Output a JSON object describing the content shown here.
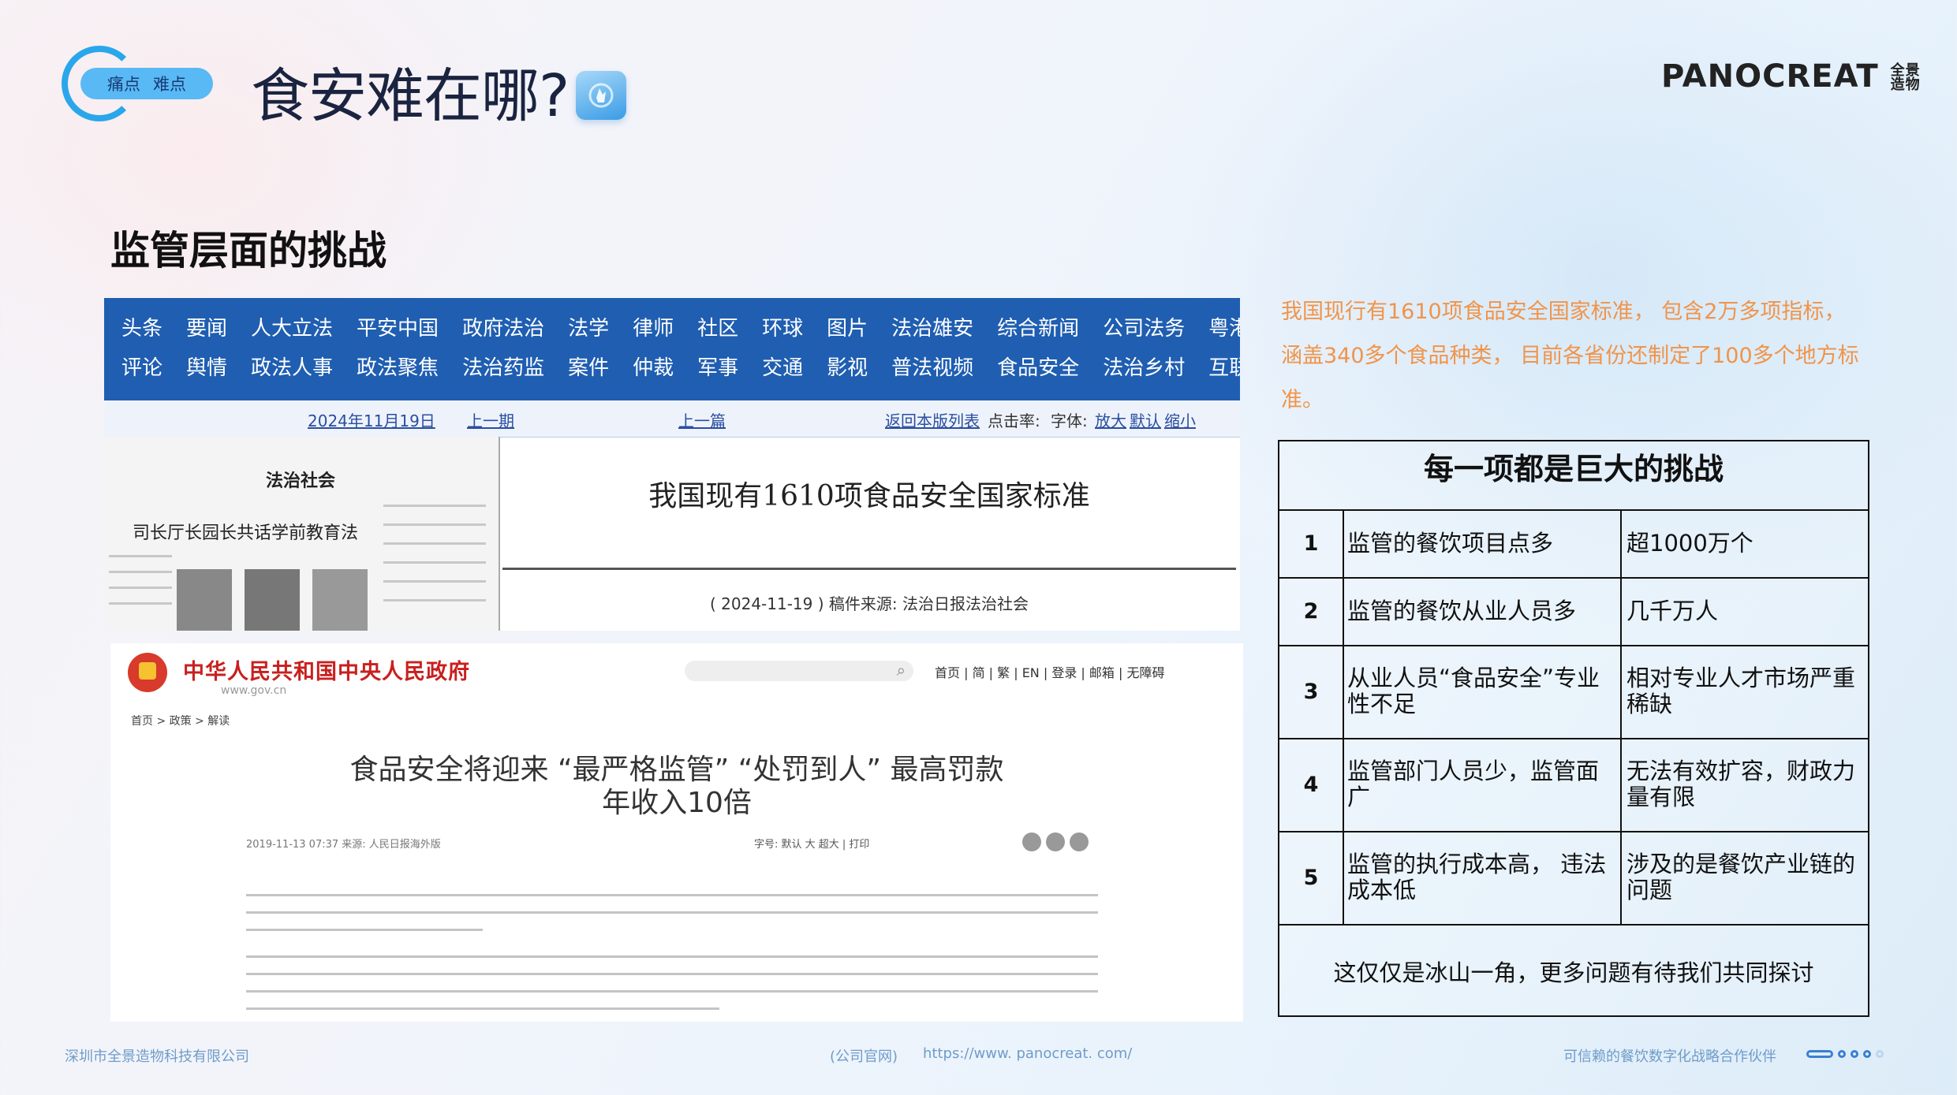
{
  "header": {
    "badge_left": "痛点",
    "badge_right": "难点",
    "title": "食安难在哪?",
    "logo_text": "PANOCREAT",
    "logo_cn": "全景造物"
  },
  "section_title": "监管层面的挑战",
  "screenshot1": {
    "nav_row1": [
      "头条",
      "要闻",
      "人大立法",
      "平安中国",
      "政府法治",
      "法学",
      "律师",
      "社区",
      "环球",
      "图片",
      "法治雄安",
      "综合新闻",
      "公司法务",
      "粤港澳大湾区"
    ],
    "nav_row2": [
      "评论",
      "舆情",
      "政法人事",
      "政法聚焦",
      "法治药监",
      "案件",
      "仲裁",
      "军事",
      "交通",
      "影视",
      "普法视频",
      "食品安全",
      "法治乡村",
      "互联网法治"
    ],
    "date": "2024年11月19日",
    "prev_page": "上一期",
    "prev_article": "上一篇",
    "return_link": "返回本版列表",
    "clicks_label": "点击率:",
    "font_label": "字体:",
    "font_big": "放大",
    "font_default": "默认",
    "font_small": "缩小",
    "paper_section": "法治社会",
    "paper_headline": "司长厅长园长共话学前教育法",
    "article_title": "我国现有1610项食品安全国家标准",
    "article_meta": "( 2024-11-19 )   稿件来源:  法治日报法治社会"
  },
  "screenshot2": {
    "gov_name": "中华人民共和国中央人民政府",
    "gov_url": "www.gov.cn",
    "nav_links": "首页 | 简 | 繁 | EN | 登录 | 邮箱 | 无障碍",
    "breadcrumb": "首页  >  政策  >  解读",
    "news_title_line1": "食品安全将迎来 “最严格监管”  “处罚到人” 最高罚款",
    "news_title_line2": "年收入10倍",
    "news_meta": "2019-11-13 07:37   来源:  人民日报海外版",
    "news_meta_right": "字号: 默认  大  超大    |   打印"
  },
  "intro_text": "我国现行有1610项食品安全国家标准， 包含2万多项指标，涵盖340多个食品种类， 目前各省份还制定了100多个地方标准。",
  "table": {
    "title": "每一项都是巨大的挑战",
    "rows": [
      {
        "num": "1",
        "item": "监管的餐饮项目点多",
        "detail": "超1000万个"
      },
      {
        "num": "2",
        "item": "监管的餐饮从业人员多",
        "detail": "几千万人"
      },
      {
        "num": "3",
        "item": "从业人员“食品安全”专业性不足",
        "detail": "相对专业人才市场严重稀缺"
      },
      {
        "num": "4",
        "item": "监管部门人员少，监管面广",
        "detail": "无法有效扩容，财政力量有限"
      },
      {
        "num": "5",
        "item": "监管的执行成本高， 违法成本低",
        "detail": "涉及的是餐饮产业链的问题"
      }
    ],
    "footer": "这仅仅是冰山一角，更多问题有待我们共同探讨"
  },
  "footer": {
    "company": "深圳市全景造物科技有限公司",
    "website_label": "(公司官网)",
    "website_url": "https://www. panocreat. com/",
    "slogan": "可信赖的餐饮数字化战略合作伙伴"
  }
}
